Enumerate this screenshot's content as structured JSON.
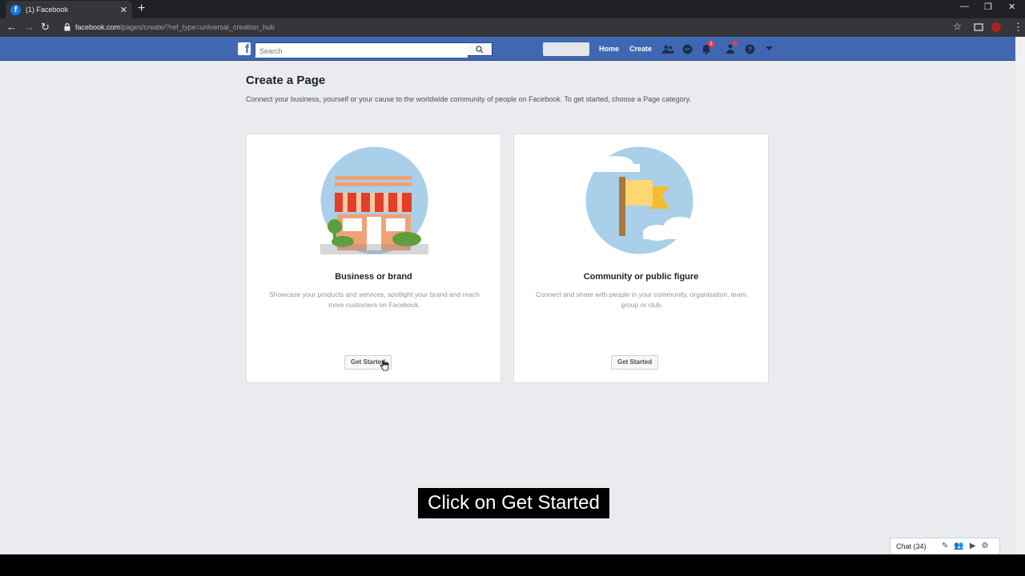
{
  "browser": {
    "tab_title": "(1) Facebook",
    "tab_favicon": "f",
    "url_host": "facebook.com",
    "url_path": "/pages/create/?ref_type=universal_creation_hub"
  },
  "header": {
    "logo": "f",
    "search_placeholder": "Search",
    "home_label": "Home",
    "create_label": "Create",
    "notification_count": "1",
    "colors": {
      "bar": "#4267b2"
    }
  },
  "main": {
    "title": "Create a Page",
    "subtitle": "Connect your business, yourself or your cause to the worldwide community of people on Facebook. To get started, choose a Page category.",
    "cards": [
      {
        "title": "Business or brand",
        "description": "Showcase your products and services, spotlight your brand and reach more customers on Facebook.",
        "button": "Get Started"
      },
      {
        "title": "Community or public figure",
        "description": "Connect and share with people in your community, organisation, team, group or club.",
        "button": "Get Started"
      }
    ]
  },
  "caption": "Click on Get Started",
  "chat": {
    "label": "Chat (34)"
  }
}
